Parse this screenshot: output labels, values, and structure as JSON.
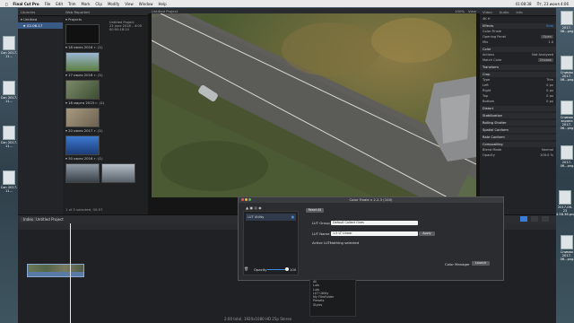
{
  "menubar": {
    "apple": "",
    "app_name": "Final Cut Pro",
    "items": [
      "File",
      "Edit",
      "Trim",
      "Mark",
      "Clip",
      "Modify",
      "View",
      "Window",
      "Help"
    ],
    "clock": "Пт, 23 июня 4:06",
    "time": "41:08:38"
  },
  "desktop": {
    "right_labels": [
      "2017-06...png",
      "Снимок 2017-06...png",
      "Снимок экрана 2017-06...png",
      "2017-06...png",
      "2017-06-23 4.58.36.png",
      "Снимок 2017-06...png"
    ],
    "left_labels": [
      "Con 2017-11...",
      "Con 2017-11...",
      "Con 2017-11...",
      "Con 2017-11..."
    ]
  },
  "libraries": {
    "header": "Libraries",
    "items": [
      "Untitled",
      "02-06-17"
    ]
  },
  "browser": {
    "header": "Web Reported",
    "project": {
      "label": "Projects",
      "title": "Untitled Project",
      "meta1": "23 June 2018 – 4:00",
      "meta2": "00:00:18:24"
    },
    "groups": [
      {
        "label": "18 июля 2016 г.",
        "count": "(1)"
      },
      {
        "label": "17 июля 2016 г.",
        "count": "(1)"
      },
      {
        "label": "18 марта 2015 г.",
        "count": "(1)"
      },
      {
        "label": "20 июля 2017 г.",
        "count": "(1)"
      },
      {
        "label": "30 июля 2016 г.",
        "count": "(1)"
      }
    ],
    "footer": "1 of 5 selected, 00:57"
  },
  "viewer": {
    "header_left": "Untitled Project",
    "zoom": "100%",
    "view": "View"
  },
  "inspector": {
    "title": "4K H",
    "tabs": [
      "Video",
      "Audio",
      "Info"
    ],
    "sections": [
      {
        "name": "Effects",
        "rows": [
          [
            "Color Finale",
            ""
          ],
          [
            "Opening Panel",
            "Open"
          ],
          [
            "Mix",
            "1.0"
          ]
        ]
      },
      {
        "name": "Color",
        "rows": [
          [
            "Actions",
            "Not Analyzed"
          ],
          [
            "Match Color",
            "Choose"
          ]
        ]
      },
      {
        "name": "Transform",
        "rows": []
      },
      {
        "name": "Crop",
        "rows": [
          [
            "Type",
            "Trim"
          ],
          [
            "Left",
            "0 px"
          ],
          [
            "Right",
            "0 px"
          ],
          [
            "Top",
            "0 px"
          ],
          [
            "Bottom",
            "0 px"
          ]
        ]
      },
      {
        "name": "Distort",
        "rows": []
      },
      {
        "name": "Stabilization",
        "rows": []
      },
      {
        "name": "Rolling Shutter",
        "rows": []
      },
      {
        "name": "Spatial Conform",
        "rows": []
      },
      {
        "name": "Rate Conform",
        "rows": []
      },
      {
        "name": "Compositing",
        "rows": [
          [
            "Blend Mode",
            "Normal"
          ],
          [
            "Opacity",
            "100.0 %"
          ]
        ]
      }
    ]
  },
  "timeline": {
    "index": "Index",
    "project": "Untitled Project",
    "timecode": "00:00:00:00",
    "footer": "2:00 total, 1920x1080 HD 25p Stereo"
  },
  "color_finale": {
    "title": "Color Finale v 2.2.3 (100)",
    "reset_all": "Reset All",
    "layer_name": "LUT Utility",
    "lut_group_label": "LUT Group",
    "lut_group_value": "Default Collect Ones",
    "lut_name_label": "LUT Name",
    "lut_name_value": "1.5 LT Linear",
    "apply": "Apply",
    "active_lut_label": "Active LUT:",
    "active_lut_value": "Nothing selected",
    "opacity_label": "Opacity",
    "opacity_value": "100",
    "color_manager": "Color Manager",
    "launch": "Launch"
  },
  "effects_menu": {
    "items": [
      "All",
      "Luts",
      "Luts",
      "LUT Utility",
      "My FilmFolder",
      "Presets",
      "Styles"
    ]
  },
  "colors": {
    "accent": "#3b8ee8",
    "clip": "#5a7aa6"
  }
}
